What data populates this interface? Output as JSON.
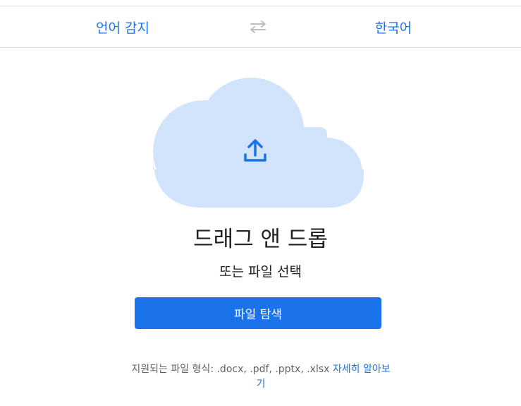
{
  "language_bar": {
    "source_label": "언어 감지",
    "target_label": "한국어",
    "swap_icon": "swap-arrows-icon"
  },
  "drop_zone": {
    "icon": "cloud-upload-icon",
    "title": "드래그 앤 드롭",
    "subtitle": "또는 파일 선택",
    "browse_button_label": "파일 탐색",
    "supported_formats_text": "지원되는 파일 형식: .docx, .pdf, .pptx, .xlsx",
    "learn_more_label": "자세히 알아보기"
  },
  "colors": {
    "accent": "#1a73e8",
    "cloud_fill": "#d2e3fc",
    "text_primary": "#202124",
    "text_secondary": "#5f6368",
    "divider": "#dadce0",
    "swap_icon": "#bdc1c6"
  }
}
